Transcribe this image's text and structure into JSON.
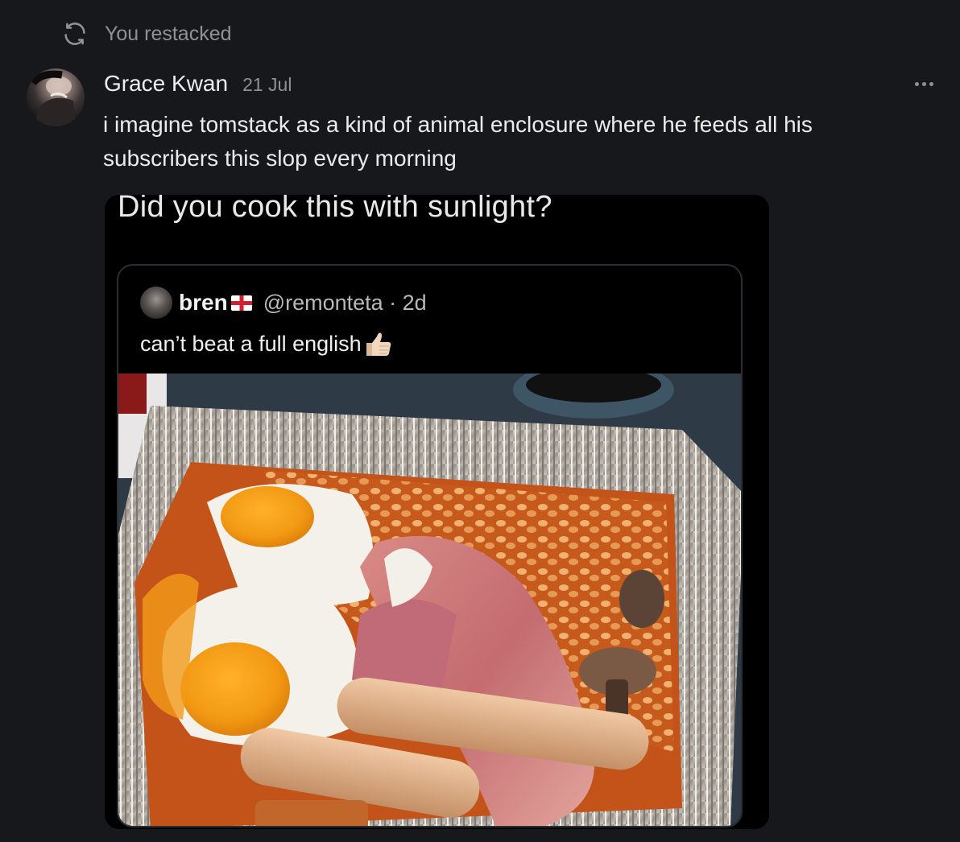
{
  "restack": {
    "icon": "restack-icon",
    "label": "You restacked"
  },
  "post": {
    "author": "Grace Kwan",
    "date": "21 Jul",
    "body": "i imagine tomstack as a kind of animal enclosure where he feeds all his subscribers this slop every morning",
    "more_icon": "more-horizontal-icon"
  },
  "media": {
    "caption": "Did you cook this with sunlight?",
    "quoted_tweet": {
      "name": "bren",
      "flag_icon": "england-flag-icon",
      "handle_meta": "@remonteta · 2d",
      "text": "can’t beat a full english",
      "emoji_icon": "thumbs-up-icon"
    }
  },
  "colors": {
    "background": "#17181b",
    "muted_text": "#8f9197",
    "card_background": "#000000"
  }
}
